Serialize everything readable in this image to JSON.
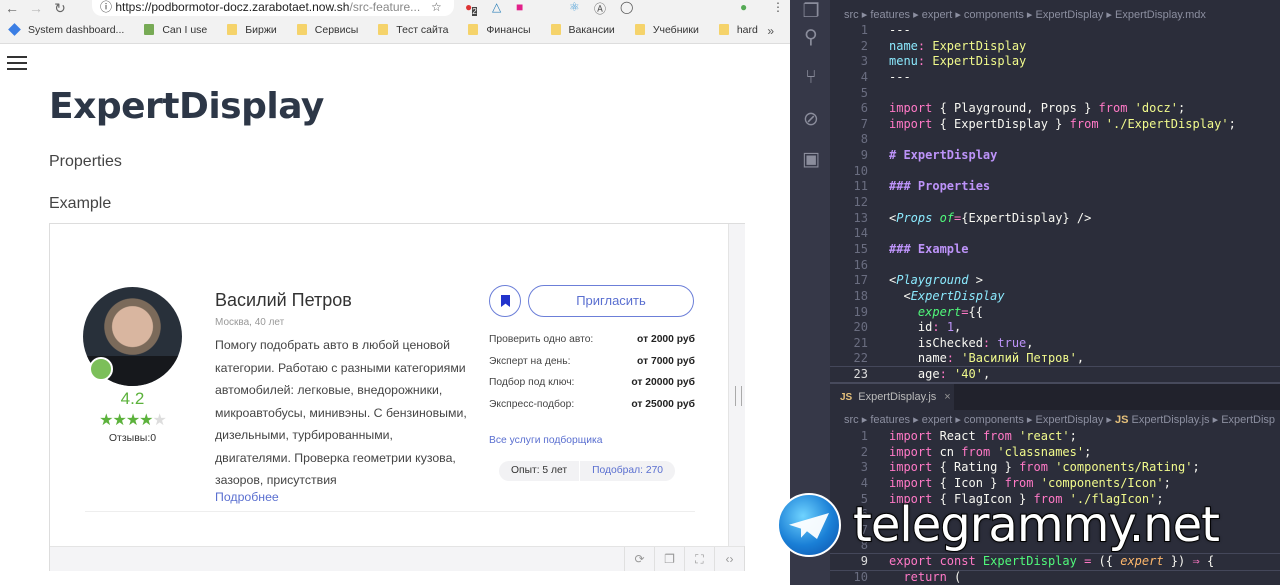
{
  "browser": {
    "url_host": "https://podbormotor-docz.zarabotaet.now.sh",
    "url_path": "/src-feature...",
    "extension_badge": "2",
    "bookmarks": [
      {
        "label": "System dashboard...",
        "icon": "jira-icon"
      },
      {
        "label": "Can I use",
        "icon": "caniuse-icon"
      },
      {
        "label": "Биржи",
        "icon": "folder-icon"
      },
      {
        "label": "Сервисы",
        "icon": "folder-icon"
      },
      {
        "label": "Тест сайта",
        "icon": "folder-icon"
      },
      {
        "label": "Финансы",
        "icon": "folder-icon"
      },
      {
        "label": "Вакансии",
        "icon": "folder-icon"
      },
      {
        "label": "Учебники",
        "icon": "folder-icon"
      },
      {
        "label": "hard",
        "icon": "folder-icon"
      }
    ],
    "more": "»"
  },
  "page": {
    "title": "ExpertDisplay",
    "properties": "Properties",
    "example": "Example"
  },
  "expert": {
    "name": "Василий Петров",
    "city_age": "Москва, 40 лет",
    "rating": "4.2",
    "stars_filled": 4,
    "stars_total": 5,
    "reviews": "Отзывы:0",
    "description": "Помогу подобрать авто в любой ценовой категории. Работаю с разными категориями автомобилей: легковые, внедорожники, микроавтобусы, минивэны. С бензиновыми, дизельными, турбированными, двигателями. Проверка геометрии кузова, зазоров, присутствия",
    "more_link": "Подробнее",
    "invite_label": "Пригласить",
    "prices": [
      {
        "label": "Проверить одно авто:",
        "value": "от 2000 руб"
      },
      {
        "label": "Эксперт на день:",
        "value": "от 7000 руб"
      },
      {
        "label": "Подбор под ключ:",
        "value": "от 20000 руб"
      },
      {
        "label": "Экспресс-подбор:",
        "value": "от 25000 руб"
      }
    ],
    "all_services": "Все услуги подборщика",
    "experience": "Опыт: 5 лет",
    "selected": "Подобрал: 270",
    "accent": "#5a6fd0",
    "rating_color": "#5cb23c"
  },
  "editor": {
    "top_breadcrumb": [
      "src",
      "features",
      "expert",
      "components",
      "ExpertDisplay",
      "ExpertDisplay.mdx"
    ],
    "top_lines": [
      [
        [
          "p",
          "---"
        ]
      ],
      [
        [
          "y",
          "name"
        ],
        [
          "o",
          ": "
        ],
        [
          "s",
          "ExpertDisplay"
        ]
      ],
      [
        [
          "y",
          "menu"
        ],
        [
          "o",
          ": "
        ],
        [
          "s",
          "ExpertDisplay"
        ]
      ],
      [
        [
          "p",
          "---"
        ]
      ],
      [],
      [
        [
          "k",
          "import"
        ],
        [
          "p",
          " { Playground, Props } "
        ],
        [
          "k",
          "from"
        ],
        [
          "s",
          " 'docz'"
        ],
        [
          "p",
          ";"
        ]
      ],
      [
        [
          "k",
          "import"
        ],
        [
          "p",
          " { ExpertDisplay } "
        ],
        [
          "k",
          "from"
        ],
        [
          "s",
          " './ExpertDisplay'"
        ],
        [
          "p",
          ";"
        ]
      ],
      [],
      [
        [
          "h",
          "# ExpertDisplay"
        ]
      ],
      [],
      [
        [
          "h",
          "### Properties"
        ]
      ],
      [],
      [
        [
          "p",
          "<"
        ],
        [
          "c",
          "Props"
        ],
        [
          "a",
          " of"
        ],
        [
          "o",
          "="
        ],
        [
          "p",
          "{ExpertDisplay} />"
        ]
      ],
      [],
      [
        [
          "h",
          "### Example"
        ]
      ],
      [],
      [
        [
          "p",
          "<"
        ],
        [
          "c",
          "Playground"
        ],
        [
          "p",
          " >"
        ]
      ],
      [
        [
          "p",
          "  <"
        ],
        [
          "c",
          "ExpertDisplay"
        ]
      ],
      [
        [
          "a",
          "    expert"
        ],
        [
          "o",
          "="
        ],
        [
          "p",
          "{{"
        ]
      ],
      [
        [
          "p",
          "    id"
        ],
        [
          "o",
          ": "
        ],
        [
          "b",
          "1"
        ],
        [
          "p",
          ","
        ]
      ],
      [
        [
          "p",
          "    isChecked"
        ],
        [
          "o",
          ": "
        ],
        [
          "b",
          "true"
        ],
        [
          "p",
          ","
        ]
      ],
      [
        [
          "p",
          "    name"
        ],
        [
          "o",
          ": "
        ],
        [
          "s",
          "'Василий Петров'"
        ],
        [
          "p",
          ","
        ]
      ],
      [
        [
          "p",
          "    age"
        ],
        [
          "o",
          ": "
        ],
        [
          "s",
          "'40'"
        ],
        [
          "p",
          ","
        ]
      ]
    ],
    "bottom_tab": "ExpertDisplay.js",
    "bottom_tab_lang": "JS",
    "bottom_breadcrumb": [
      "src",
      "features",
      "expert",
      "components",
      "ExpertDisplay",
      "ExpertDisplay.js",
      "ExpertDisp"
    ],
    "bottom_lines": [
      [
        [
          "k",
          "import"
        ],
        [
          "p",
          " React "
        ],
        [
          "k",
          "from"
        ],
        [
          "s",
          " 'react'"
        ],
        [
          "p",
          ";"
        ]
      ],
      [
        [
          "k",
          "import"
        ],
        [
          "p",
          " cn "
        ],
        [
          "k",
          "from"
        ],
        [
          "s",
          " 'classnames'"
        ],
        [
          "p",
          ";"
        ]
      ],
      [
        [
          "k",
          "import"
        ],
        [
          "p",
          " { Rating } "
        ],
        [
          "k",
          "from"
        ],
        [
          "s",
          " 'components/Rating'"
        ],
        [
          "p",
          ";"
        ]
      ],
      [
        [
          "k",
          "import"
        ],
        [
          "p",
          " { Icon } "
        ],
        [
          "k",
          "from"
        ],
        [
          "s",
          " 'components/Icon'"
        ],
        [
          "p",
          ";"
        ]
      ],
      [
        [
          "k",
          "import"
        ],
        [
          "p",
          " { FlagIcon } "
        ],
        [
          "k",
          "from"
        ],
        [
          "s",
          " './flagIcon'"
        ],
        [
          "p",
          ";"
        ]
      ],
      [],
      [],
      [],
      [
        [
          "k",
          "export const "
        ],
        [
          "g",
          "ExpertDisplay"
        ],
        [
          "o",
          " = "
        ],
        [
          "p",
          "({ "
        ],
        [
          "i",
          "expert"
        ],
        [
          "p",
          " }) "
        ],
        [
          "o",
          "⇒"
        ],
        [
          "p",
          " {"
        ]
      ],
      [
        [
          "k",
          "  return"
        ],
        [
          "p",
          " ("
        ]
      ]
    ],
    "watermark": "telegrammy.net"
  }
}
